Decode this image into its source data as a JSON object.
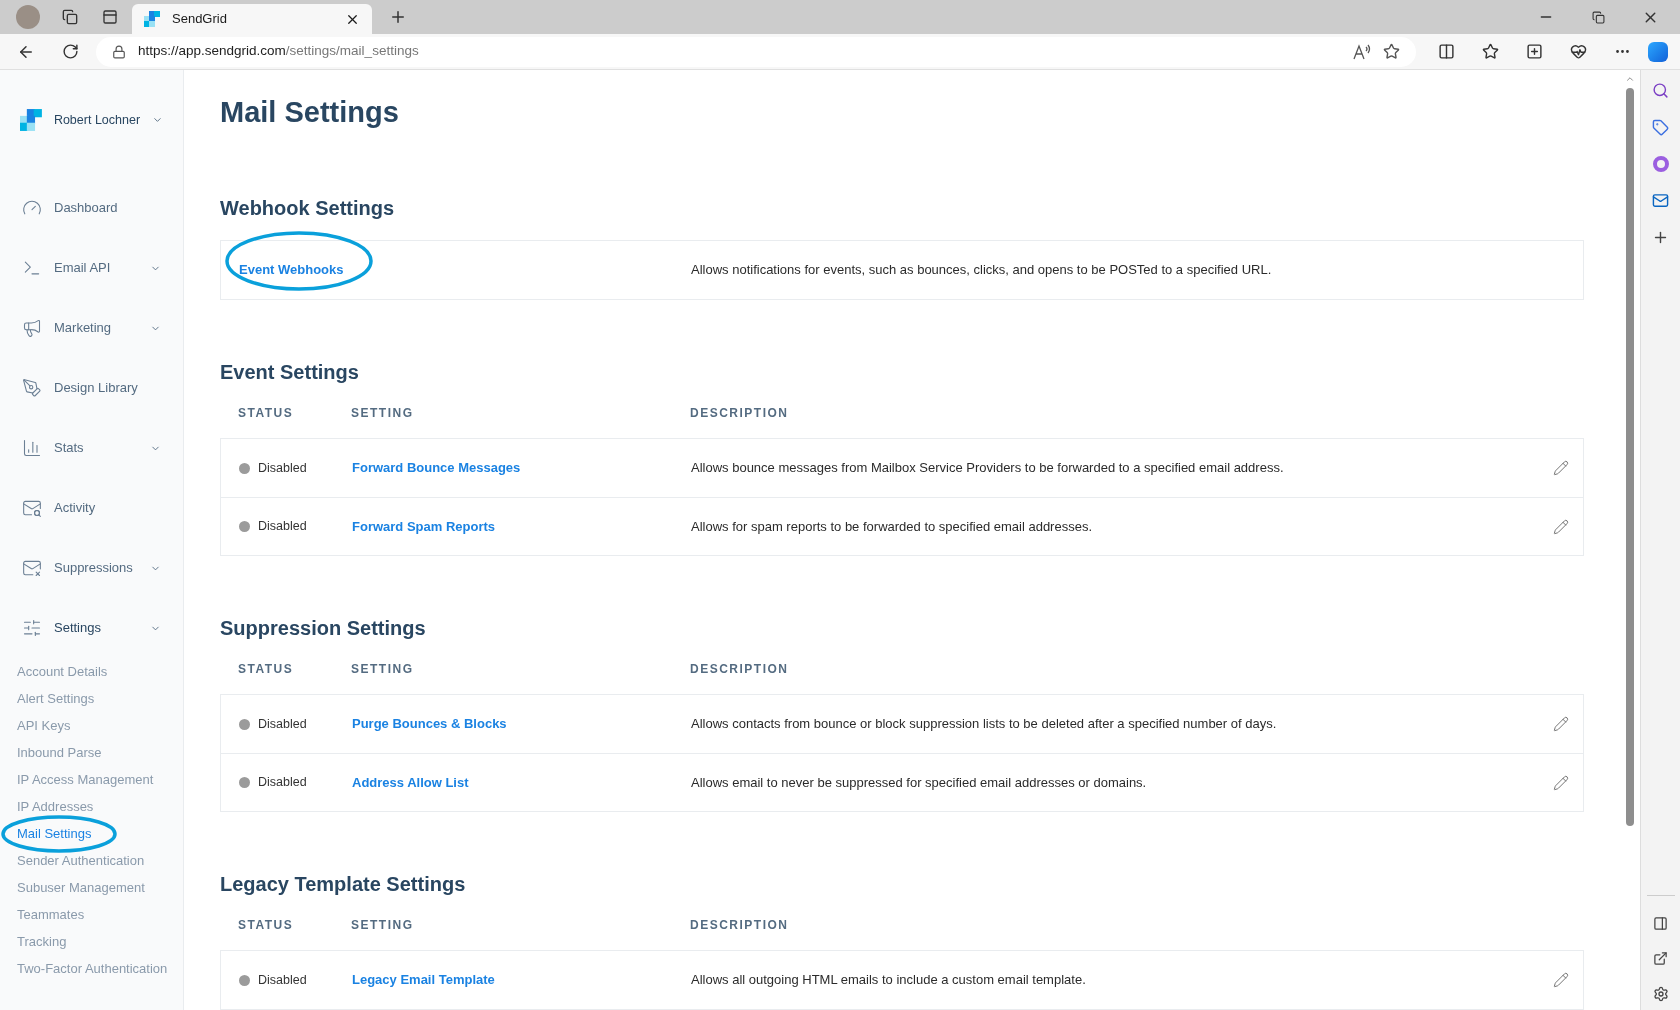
{
  "browser": {
    "tab_title": "SendGrid",
    "url_host": "https://app.sendgrid.com",
    "url_path": "/settings/mail_settings"
  },
  "sidebar": {
    "account_name": "Robert Lochner",
    "items": [
      {
        "label": "Dashboard",
        "has_submenu": false
      },
      {
        "label": "Email API",
        "has_submenu": true
      },
      {
        "label": "Marketing",
        "has_submenu": true
      },
      {
        "label": "Design Library",
        "has_submenu": false
      },
      {
        "label": "Stats",
        "has_submenu": true
      },
      {
        "label": "Activity",
        "has_submenu": false
      },
      {
        "label": "Suppressions",
        "has_submenu": true
      },
      {
        "label": "Settings",
        "has_submenu": true
      }
    ],
    "sub_items": [
      {
        "label": "Account Details",
        "selected": false
      },
      {
        "label": "Alert Settings",
        "selected": false
      },
      {
        "label": "API Keys",
        "selected": false
      },
      {
        "label": "Inbound Parse",
        "selected": false
      },
      {
        "label": "IP Access Management",
        "selected": false
      },
      {
        "label": "IP Addresses",
        "selected": false
      },
      {
        "label": "Mail Settings",
        "selected": true
      },
      {
        "label": "Sender Authentication",
        "selected": false
      },
      {
        "label": "Subuser Management",
        "selected": false
      },
      {
        "label": "Teammates",
        "selected": false
      },
      {
        "label": "Tracking",
        "selected": false
      },
      {
        "label": "Two-Factor Authentication",
        "selected": false
      }
    ]
  },
  "page": {
    "title": "Mail Settings",
    "sections": [
      {
        "title": "Webhook Settings",
        "kind": "links",
        "rows": [
          {
            "setting": "Event Webhooks",
            "description": "Allows notifications for events, such as bounces, clicks, and opens to be POSTed to a specified URL.",
            "circled": true
          }
        ]
      },
      {
        "title": "Event Settings",
        "kind": "table",
        "columns": [
          "STATUS",
          "SETTING",
          "DESCRIPTION"
        ],
        "rows": [
          {
            "on": false,
            "status": "Disabled",
            "setting": "Forward Bounce Messages",
            "description": "Allows bounce messages from Mailbox Service Providers to be forwarded to a specified email address."
          },
          {
            "on": false,
            "status": "Disabled",
            "setting": "Forward Spam Reports",
            "description": "Allows for spam reports to be forwarded to specified email addresses."
          }
        ]
      },
      {
        "title": "Suppression Settings",
        "kind": "table",
        "columns": [
          "STATUS",
          "SETTING",
          "DESCRIPTION"
        ],
        "rows": [
          {
            "on": false,
            "status": "Disabled",
            "setting": "Purge Bounces & Blocks",
            "description": "Allows contacts from bounce or block suppression lists to be deleted after a specified number of days."
          },
          {
            "on": false,
            "status": "Disabled",
            "setting": "Address Allow List",
            "description": "Allows email to never be suppressed for specified email addresses or domains."
          }
        ]
      },
      {
        "title": "Legacy Template Settings",
        "kind": "table",
        "columns": [
          "STATUS",
          "SETTING",
          "DESCRIPTION"
        ],
        "rows": [
          {
            "on": false,
            "status": "Disabled",
            "setting": "Legacy Email Template",
            "description": "Allows all outgoing HTML emails to include a custom email template."
          }
        ]
      }
    ]
  }
}
